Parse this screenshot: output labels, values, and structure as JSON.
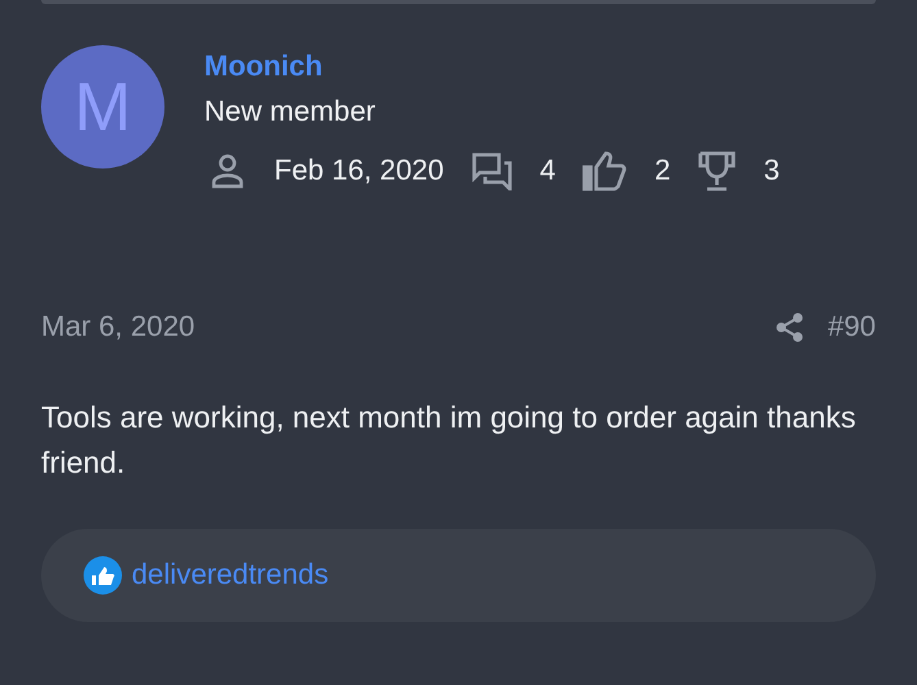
{
  "author": {
    "avatar_letter": "M",
    "name": "Moonich",
    "title": "New member",
    "stats": [
      {
        "kind": "joined",
        "value": "Feb 16, 2020"
      },
      {
        "kind": "messages",
        "value": "4"
      },
      {
        "kind": "reactions",
        "value": "2"
      },
      {
        "kind": "trophies",
        "value": "3"
      }
    ]
  },
  "post": {
    "date": "Mar 6, 2020",
    "number": "#90",
    "body": "Tools are working, next month im going to order again thanks friend."
  },
  "reactions": {
    "users": [
      "deliveredtrends"
    ]
  }
}
